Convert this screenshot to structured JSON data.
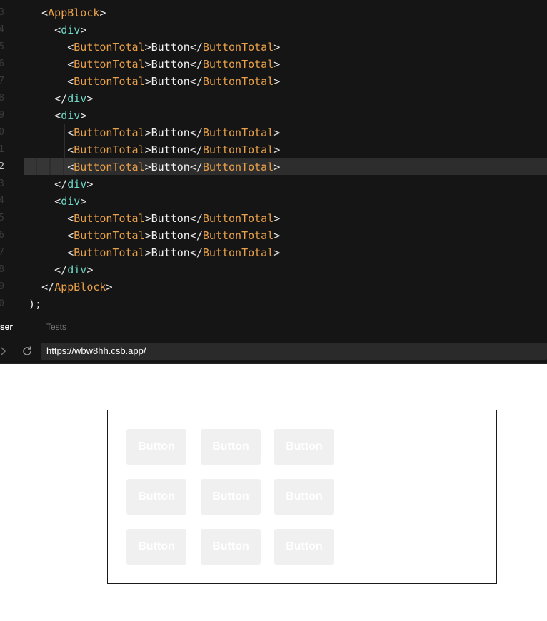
{
  "editor": {
    "lines": [
      {
        "num": "3",
        "active": false,
        "tokens": [
          [
            "t-punct",
            "    <"
          ],
          [
            "t-comp",
            "AppBlock"
          ],
          [
            "t-punct",
            ">"
          ]
        ]
      },
      {
        "num": "4",
        "active": false,
        "tokens": [
          [
            "t-punct",
            "      <"
          ],
          [
            "t-html",
            "div"
          ],
          [
            "t-punct",
            ">"
          ]
        ]
      },
      {
        "num": "5",
        "active": false,
        "tokens": [
          [
            "t-punct",
            "        <"
          ],
          [
            "t-comp",
            "ButtonTotal"
          ],
          [
            "t-punct",
            ">"
          ],
          [
            "t-text",
            "Button"
          ],
          [
            "t-punct",
            "</"
          ],
          [
            "t-comp",
            "ButtonTotal"
          ],
          [
            "t-punct",
            ">"
          ]
        ]
      },
      {
        "num": "6",
        "active": false,
        "tokens": [
          [
            "t-punct",
            "        <"
          ],
          [
            "t-comp",
            "ButtonTotal"
          ],
          [
            "t-punct",
            ">"
          ],
          [
            "t-text",
            "Button"
          ],
          [
            "t-punct",
            "</"
          ],
          [
            "t-comp",
            "ButtonTotal"
          ],
          [
            "t-punct",
            ">"
          ]
        ]
      },
      {
        "num": "7",
        "active": false,
        "tokens": [
          [
            "t-punct",
            "        <"
          ],
          [
            "t-comp",
            "ButtonTotal"
          ],
          [
            "t-punct",
            ">"
          ],
          [
            "t-text",
            "Button"
          ],
          [
            "t-punct",
            "</"
          ],
          [
            "t-comp",
            "ButtonTotal"
          ],
          [
            "t-punct",
            ">"
          ]
        ]
      },
      {
        "num": "8",
        "active": false,
        "tokens": [
          [
            "t-punct",
            "      </"
          ],
          [
            "t-html",
            "div"
          ],
          [
            "t-punct",
            ">"
          ]
        ]
      },
      {
        "num": "9",
        "active": false,
        "tokens": [
          [
            "t-punct",
            "      <"
          ],
          [
            "t-html",
            "div"
          ],
          [
            "t-punct",
            ">"
          ]
        ]
      },
      {
        "num": "0",
        "active": false,
        "tokens": [
          [
            "t-punct",
            "        <"
          ],
          [
            "t-comp",
            "ButtonTotal"
          ],
          [
            "t-punct",
            ">"
          ],
          [
            "t-text",
            "Button"
          ],
          [
            "t-punct",
            "</"
          ],
          [
            "t-comp",
            "ButtonTotal"
          ],
          [
            "t-punct",
            ">"
          ]
        ]
      },
      {
        "num": "1",
        "active": false,
        "tokens": [
          [
            "t-punct",
            "        <"
          ],
          [
            "t-comp",
            "ButtonTotal"
          ],
          [
            "t-punct",
            ">"
          ],
          [
            "t-text",
            "Button"
          ],
          [
            "t-punct",
            "</"
          ],
          [
            "t-comp",
            "ButtonTotal"
          ],
          [
            "t-punct",
            ">"
          ]
        ]
      },
      {
        "num": "2",
        "active": true,
        "tokens": [
          [
            "t-punct",
            "        <"
          ],
          [
            "t-comp",
            "ButtonTotal"
          ],
          [
            "t-punct",
            ">"
          ],
          [
            "t-text",
            "Button"
          ],
          [
            "t-punct",
            "</"
          ],
          [
            "t-comp",
            "ButtonTotal"
          ],
          [
            "t-punct",
            ">"
          ]
        ]
      },
      {
        "num": "3",
        "active": false,
        "tokens": [
          [
            "t-punct",
            "      </"
          ],
          [
            "t-html",
            "div"
          ],
          [
            "t-punct",
            ">"
          ]
        ]
      },
      {
        "num": "4",
        "active": false,
        "tokens": [
          [
            "t-punct",
            "      <"
          ],
          [
            "t-html",
            "div"
          ],
          [
            "t-punct",
            ">"
          ]
        ]
      },
      {
        "num": "5",
        "active": false,
        "tokens": [
          [
            "t-punct",
            "        <"
          ],
          [
            "t-comp",
            "ButtonTotal"
          ],
          [
            "t-punct",
            ">"
          ],
          [
            "t-text",
            "Button"
          ],
          [
            "t-punct",
            "</"
          ],
          [
            "t-comp",
            "ButtonTotal"
          ],
          [
            "t-punct",
            ">"
          ]
        ]
      },
      {
        "num": "6",
        "active": false,
        "tokens": [
          [
            "t-punct",
            "        <"
          ],
          [
            "t-comp",
            "ButtonTotal"
          ],
          [
            "t-punct",
            ">"
          ],
          [
            "t-text",
            "Button"
          ],
          [
            "t-punct",
            "</"
          ],
          [
            "t-comp",
            "ButtonTotal"
          ],
          [
            "t-punct",
            ">"
          ]
        ]
      },
      {
        "num": "7",
        "active": false,
        "tokens": [
          [
            "t-punct",
            "        <"
          ],
          [
            "t-comp",
            "ButtonTotal"
          ],
          [
            "t-punct",
            ">"
          ],
          [
            "t-text",
            "Button"
          ],
          [
            "t-punct",
            "</"
          ],
          [
            "t-comp",
            "ButtonTotal"
          ],
          [
            "t-punct",
            ">"
          ]
        ]
      },
      {
        "num": "8",
        "active": false,
        "tokens": [
          [
            "t-punct",
            "      </"
          ],
          [
            "t-html",
            "div"
          ],
          [
            "t-punct",
            ">"
          ]
        ]
      },
      {
        "num": "9",
        "active": false,
        "tokens": [
          [
            "t-punct",
            "    </"
          ],
          [
            "t-comp",
            "AppBlock"
          ],
          [
            "t-punct",
            ">"
          ]
        ]
      },
      {
        "num": "0",
        "active": false,
        "tokens": [
          [
            "t-punct",
            "  );"
          ]
        ]
      }
    ]
  },
  "tabs": {
    "browser": "ser",
    "tests": "Tests"
  },
  "addressbar": {
    "back_icon": "chevron-right-icon",
    "refresh_icon": "refresh-icon",
    "url": "https://wbw8hh.csb.app/"
  },
  "preview": {
    "rows": [
      [
        "Button",
        "Button",
        "Button"
      ],
      [
        "Button",
        "Button",
        "Button"
      ],
      [
        "Button",
        "Button",
        "Button"
      ]
    ]
  }
}
